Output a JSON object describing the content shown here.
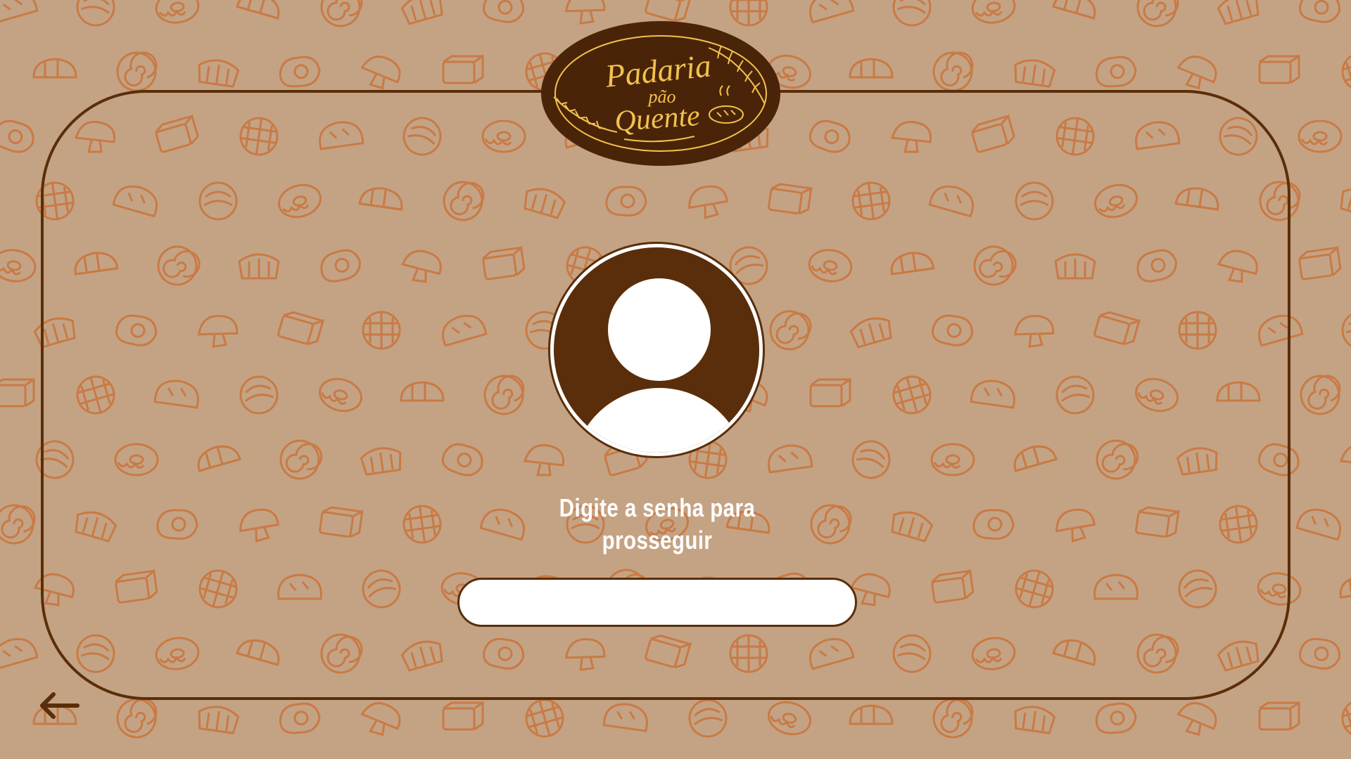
{
  "app": {
    "brand": {
      "line1": "Padaria",
      "line2": "pão",
      "line3": "Quente"
    }
  },
  "colors": {
    "background": "#c4a384",
    "pattern_stroke": "#c97a45",
    "frame": "#5a2e0a",
    "logo_fill": "#4a2408",
    "logo_text": "#f2c14e",
    "white": "#ffffff"
  },
  "login": {
    "prompt": "Digite a senha para prosseguir",
    "password_value": ""
  },
  "icons": {
    "avatar": "user-avatar-icon",
    "back": "arrow-left-icon",
    "wheat": "wheat-icon",
    "bread": "bread-icon"
  }
}
